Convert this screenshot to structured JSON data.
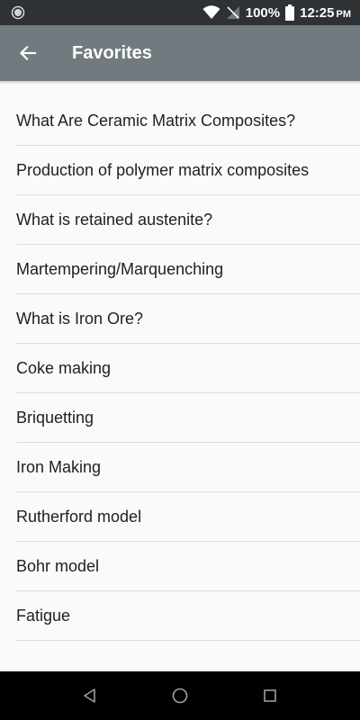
{
  "status_bar": {
    "battery_percent": "100%",
    "time": "12:25",
    "ampm": "PM"
  },
  "app_bar": {
    "title": "Favorites"
  },
  "favorites": [
    "What Are Ceramic Matrix Composites?",
    "Production of polymer matrix composites",
    "What is retained austenite?",
    "Martempering/Marquenching",
    "What is Iron Ore?",
    "Coke making",
    "Briquetting",
    "Iron Making",
    "Rutherford model",
    "Bohr model",
    "Fatigue"
  ],
  "icons": {
    "back": "arrow-left-icon",
    "nav_back": "triangle-back-icon",
    "nav_home": "circle-home-icon",
    "nav_recents": "square-recents-icon"
  },
  "colors": {
    "status_bar": "#2e3235",
    "app_bar": "#717a7f",
    "background": "#fafafa",
    "text": "#212121"
  }
}
